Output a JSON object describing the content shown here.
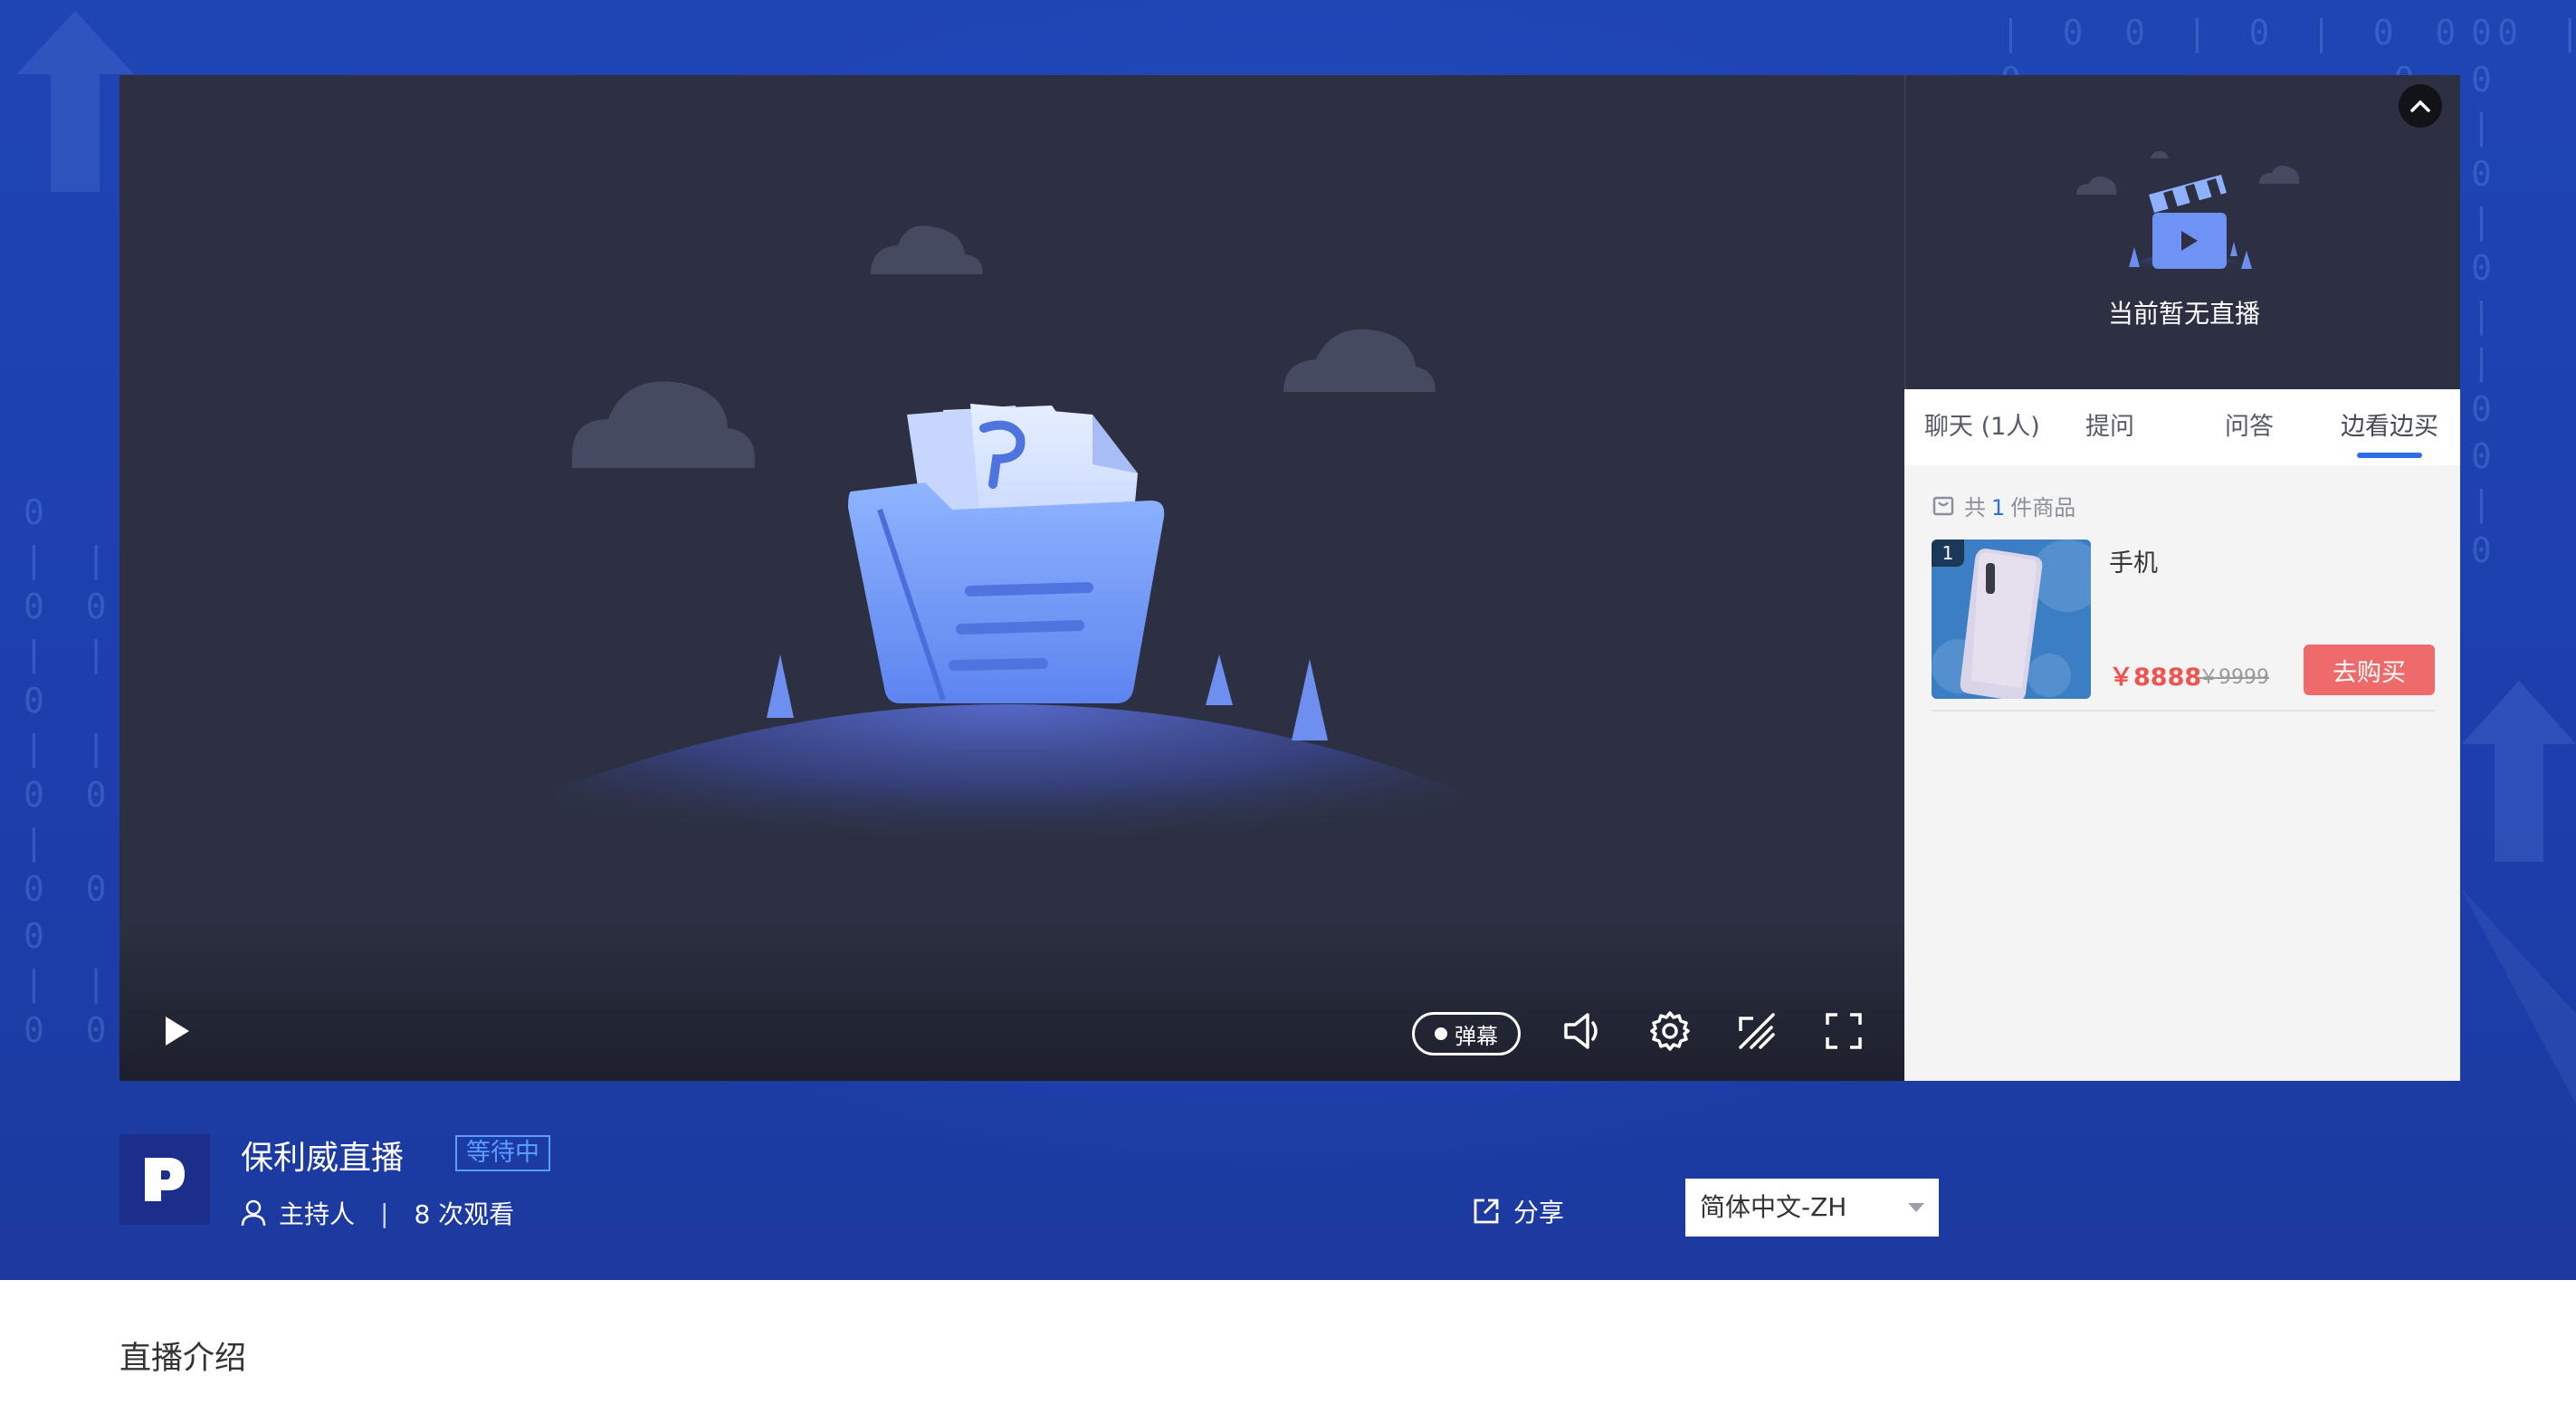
{
  "player": {
    "danmu_label": "弹幕"
  },
  "side_panel": {
    "no_live_text": "当前暂无直播",
    "tabs": [
      {
        "label": "聊天 (1人)"
      },
      {
        "label": "提问"
      },
      {
        "label": "问答"
      },
      {
        "label": "边看边买"
      }
    ],
    "active_tab_index": 3,
    "goods_count_prefix": "共",
    "goods_count": "1",
    "goods_count_suffix": "件商品",
    "goods": [
      {
        "index": "1",
        "name": "手机",
        "price": "￥8888",
        "original_price": "￥9999",
        "buy_label": "去购买"
      }
    ]
  },
  "channel": {
    "name": "保利威直播",
    "status": "等待中",
    "host_label": "主持人",
    "views": "8 次观看",
    "share_label": "分享",
    "language": "简体中文-ZH"
  },
  "intro": {
    "title": "直播介绍"
  },
  "colors": {
    "hero_bg": "#1f44b4",
    "player_bg": "#2c3042",
    "accent_blue": "#2f6fe4",
    "price_red": "#ef5350",
    "buy_button": "#ef6b6b"
  }
}
